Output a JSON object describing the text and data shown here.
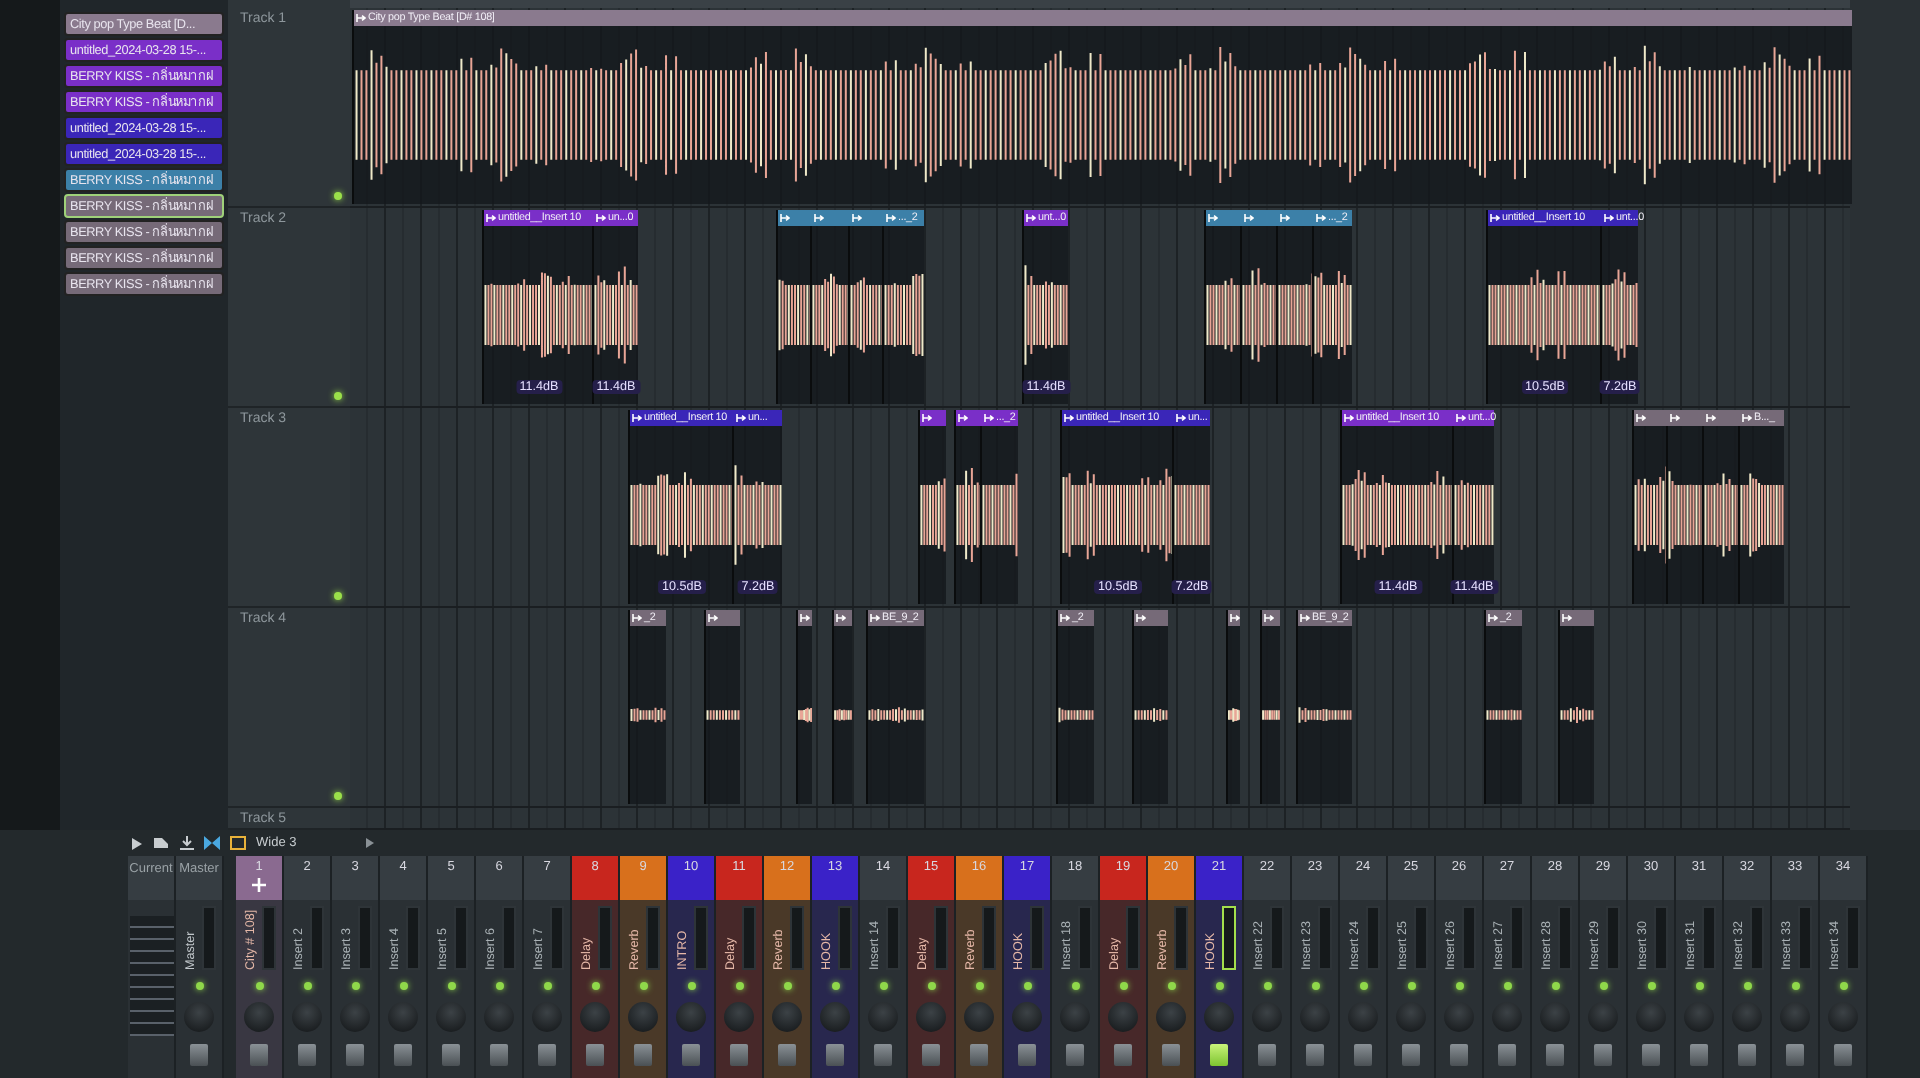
{
  "clip_list": [
    {
      "label": "City pop Type Beat [D...",
      "color": "#8a7a8e",
      "selected": false
    },
    {
      "label": "untitled_2024-03-28 15-...",
      "color": "#7a2fc8",
      "selected": false
    },
    {
      "label": "BERRY KISS - กลิ่นหมากฝ",
      "color": "#7a2fc8",
      "selected": false
    },
    {
      "label": "BERRY KISS - กลิ่นหมากฝ",
      "color": "#7a2fc8",
      "selected": false
    },
    {
      "label": "untitled_2024-03-28 15-...",
      "color": "#3a26b8",
      "selected": false
    },
    {
      "label": "untitled_2024-03-28 15-...",
      "color": "#3a26b8",
      "selected": false
    },
    {
      "label": "BERRY KISS - กลิ่นหมากฝ",
      "color": "#3c80a8",
      "selected": false
    },
    {
      "label": "BERRY KISS - กลิ่นหมากฝ",
      "color": "#766a78",
      "selected": true
    },
    {
      "label": "BERRY KISS - กลิ่นหมากฝ",
      "color": "#766a78",
      "selected": false
    },
    {
      "label": "BERRY KISS - กลิ่นหมากฝ",
      "color": "#766a78",
      "selected": false
    },
    {
      "label": "BERRY KISS - กลิ่นหมากฝ",
      "color": "#766a78",
      "selected": false
    }
  ],
  "tracks": [
    {
      "name": "Track 1",
      "clips": [
        {
          "label": "City pop Type Beat [D# 108]",
          "color": "#8a7a8e"
        }
      ]
    },
    {
      "name": "Track 2",
      "clips": [
        {
          "label": "untitled__Insert 10",
          "color": "#7a2fc8",
          "gain": "11.4dB"
        },
        {
          "label": "un...0",
          "color": "#7a2fc8",
          "gain": "11.4dB"
        },
        {
          "color": "#3c80a8"
        },
        {
          "color": "#3c80a8"
        },
        {
          "color": "#3c80a8"
        },
        {
          "label": "..._2",
          "color": "#3c80a8"
        },
        {
          "label": "unt...0",
          "color": "#7a2fc8",
          "gain": "11.4dB"
        },
        {
          "color": "#3c80a8"
        },
        {
          "color": "#3c80a8"
        },
        {
          "color": "#3c80a8"
        },
        {
          "label": "..._2",
          "color": "#3c80a8"
        },
        {
          "label": "untitled__Insert 10",
          "color": "#3a26b8",
          "gain": "10.5dB"
        },
        {
          "label": "unt...0",
          "color": "#3a26b8",
          "gain": "7.2dB"
        }
      ]
    },
    {
      "name": "Track 3",
      "clips": [
        {
          "label": "untitled__Insert 10",
          "color": "#3a26b8",
          "gain": "10.5dB"
        },
        {
          "label": "un...",
          "color": "#3a26b8",
          "gain": "7.2dB"
        },
        {
          "color": "#7a2fc8"
        },
        {
          "color": "#7a2fc8"
        },
        {
          "label": "..._2",
          "color": "#7a2fc8"
        },
        {
          "label": "untitled__Insert 10",
          "color": "#3a26b8",
          "gain": "10.5dB"
        },
        {
          "label": "un...",
          "color": "#3a26b8",
          "gain": "7.2dB"
        },
        {
          "label": "untitled__Insert 10",
          "color": "#7a2fc8",
          "gain": "11.4dB"
        },
        {
          "label": "unt...0",
          "color": "#7a2fc8",
          "gain": "11.4dB"
        },
        {
          "color": "#766a78"
        },
        {
          "color": "#766a78"
        },
        {
          "color": "#766a78"
        },
        {
          "label": "B..._",
          "color": "#766a78"
        }
      ]
    },
    {
      "name": "Track 4",
      "clips": [
        {
          "label": "_2",
          "color": "#766a78"
        },
        {
          "color": "#766a78"
        },
        {
          "color": "#766a78"
        },
        {
          "color": "#766a78"
        },
        {
          "label": "BE_9_2",
          "color": "#766a78"
        },
        {
          "label": "_2",
          "color": "#766a78"
        },
        {
          "color": "#766a78"
        },
        {
          "color": "#766a78"
        },
        {
          "color": "#766a78"
        },
        {
          "label": "BE_9_2",
          "color": "#766a78"
        },
        {
          "label": "_2",
          "color": "#766a78"
        },
        {
          "color": "#766a78"
        }
      ]
    },
    {
      "name": "Track 5"
    }
  ],
  "mixer": {
    "toolbar_label": "Wide 3",
    "current_label": "Current",
    "master_label": "Master",
    "master_name": "Master",
    "strips": [
      {
        "number": "1",
        "name": "City # 108]",
        "color": "#8a6a90",
        "plus": true,
        "selected": false
      },
      {
        "number": "2",
        "name": "Insert 2",
        "plus": false,
        "selected": false
      },
      {
        "number": "3",
        "name": "Insert 3",
        "plus": false,
        "selected": false
      },
      {
        "number": "4",
        "name": "Insert 4",
        "plus": false,
        "selected": false
      },
      {
        "number": "5",
        "name": "Insert 5",
        "plus": false,
        "selected": false
      },
      {
        "number": "6",
        "name": "Insert 6",
        "plus": false,
        "selected": false
      },
      {
        "number": "7",
        "name": "Insert 7",
        "plus": false,
        "selected": false
      },
      {
        "number": "8",
        "name": "Delay",
        "color": "#c8261e",
        "plus": false,
        "selected": false
      },
      {
        "number": "9",
        "name": "Reverb",
        "color": "#d8701c",
        "plus": false,
        "selected": false
      },
      {
        "number": "10",
        "name": "INTRO",
        "color": "#3a22c8",
        "plus": false,
        "selected": false
      },
      {
        "number": "11",
        "name": "Delay",
        "color": "#c8261e",
        "plus": false,
        "selected": false
      },
      {
        "number": "12",
        "name": "Reverb",
        "color": "#d8701c",
        "plus": false,
        "selected": false
      },
      {
        "number": "13",
        "name": "HOOK",
        "color": "#3a22c8",
        "plus": false,
        "selected": false
      },
      {
        "number": "14",
        "name": "Insert 14",
        "plus": false,
        "selected": false
      },
      {
        "number": "15",
        "name": "Delay",
        "color": "#c8261e",
        "plus": false,
        "selected": false
      },
      {
        "number": "16",
        "name": "Reverb",
        "color": "#d8701c",
        "plus": false,
        "selected": false
      },
      {
        "number": "17",
        "name": "HOOK",
        "color": "#3a22c8",
        "plus": false,
        "selected": false
      },
      {
        "number": "18",
        "name": "Insert 18",
        "plus": false,
        "selected": false
      },
      {
        "number": "19",
        "name": "Delay",
        "color": "#c8261e",
        "plus": false,
        "selected": false
      },
      {
        "number": "20",
        "name": "Reverb",
        "color": "#d8701c",
        "plus": false,
        "selected": false
      },
      {
        "number": "21",
        "name": "HOOK",
        "color": "#3a22c8",
        "plus": false,
        "selected": true
      },
      {
        "number": "22",
        "name": "Insert 22",
        "plus": false,
        "selected": false
      },
      {
        "number": "23",
        "name": "Insert 23",
        "plus": false,
        "selected": false
      },
      {
        "number": "24",
        "name": "Insert 24",
        "plus": false,
        "selected": false
      },
      {
        "number": "25",
        "name": "Insert 25",
        "plus": false,
        "selected": false
      },
      {
        "number": "26",
        "name": "Insert 26",
        "plus": false,
        "selected": false
      },
      {
        "number": "27",
        "name": "Insert 27",
        "plus": false,
        "selected": false
      },
      {
        "number": "28",
        "name": "Insert 28",
        "plus": false,
        "selected": false
      },
      {
        "number": "29",
        "name": "Insert 29",
        "plus": false,
        "selected": false
      },
      {
        "number": "30",
        "name": "Insert 30",
        "plus": false,
        "selected": false
      },
      {
        "number": "31",
        "name": "Insert 31",
        "plus": false,
        "selected": false
      },
      {
        "number": "32",
        "name": "Insert 32",
        "plus": false,
        "selected": false
      },
      {
        "number": "33",
        "name": "Insert 33",
        "plus": false,
        "selected": false
      },
      {
        "number": "34",
        "name": "Insert 34",
        "plus": false,
        "selected": false
      }
    ]
  }
}
